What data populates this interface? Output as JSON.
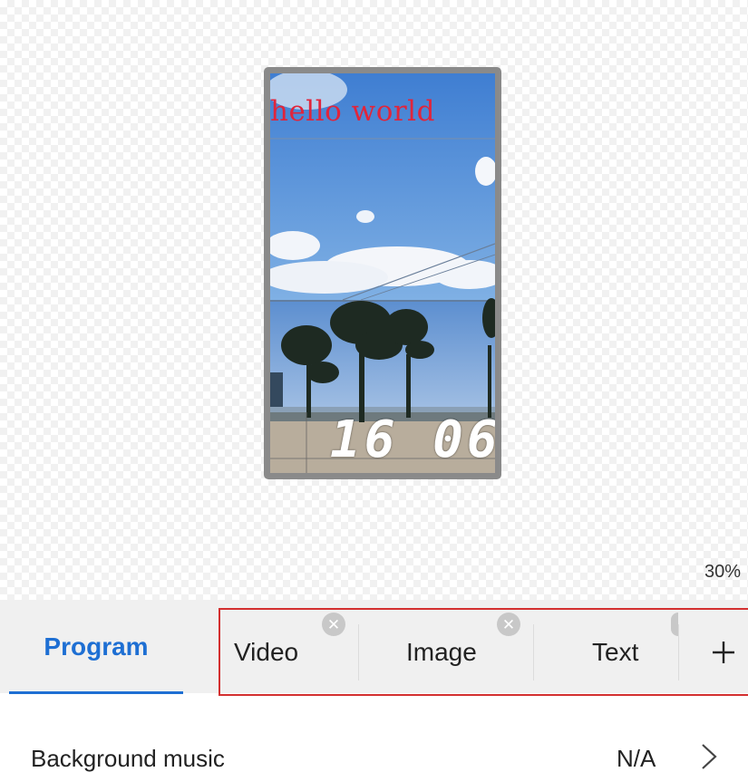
{
  "preview": {
    "overlay_text": "hello world",
    "clock_text": "16 06",
    "zoom": "30%"
  },
  "tabs": {
    "program_label": "Program",
    "elements": [
      {
        "label": "Video",
        "closable": true
      },
      {
        "label": "Image",
        "closable": true
      },
      {
        "label": "Text",
        "closable": true
      }
    ],
    "add_label": "+"
  },
  "settings": {
    "background_music_label": "Background music",
    "background_music_value": "N/A"
  },
  "icons": {
    "close": "close-icon",
    "add": "plus-icon",
    "chevron": "chevron-right-icon"
  },
  "colors": {
    "accent": "#1e6fd3",
    "overlay_text": "#e0253c",
    "highlight_border": "#d32f2f"
  }
}
